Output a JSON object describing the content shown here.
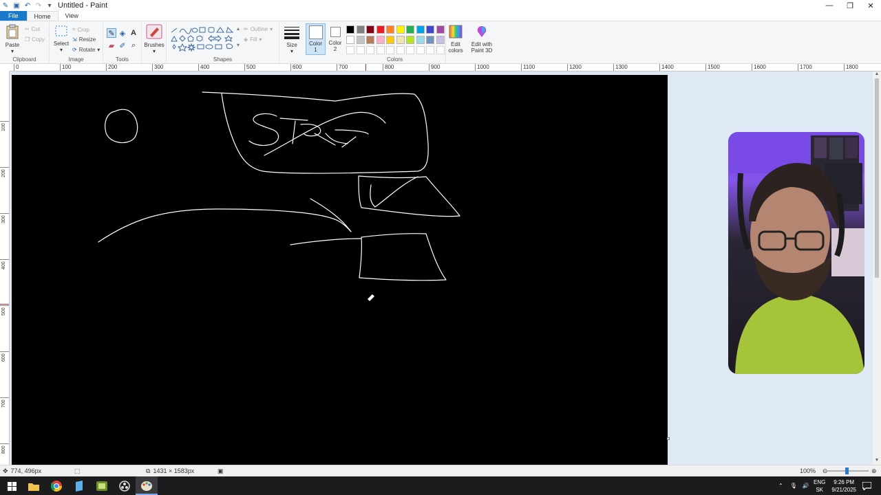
{
  "window": {
    "title": "Untitled - Paint",
    "controls": {
      "minimize": "—",
      "maximize": "❐",
      "close": "✕"
    }
  },
  "tabs": [
    "File",
    "Home",
    "View"
  ],
  "ribbon": {
    "clipboard": {
      "paste": "Paste",
      "cut": "Cut",
      "copy": "Copy",
      "label": "Clipboard"
    },
    "image": {
      "select": "Select",
      "crop": "Crop",
      "resize": "Resize",
      "rotate": "Rotate",
      "label": "Image"
    },
    "tools": {
      "label": "Tools",
      "text_tool": "A"
    },
    "brushes": {
      "label": "Brushes"
    },
    "shapes": {
      "outline": "Outline",
      "fill": "Fill",
      "label": "Shapes"
    },
    "size": {
      "label": "Size"
    },
    "color1": {
      "line1": "Color",
      "line2": "1"
    },
    "color2": {
      "line1": "Color",
      "line2": "2"
    },
    "colors": {
      "label": "Colors",
      "palette_row1": [
        "#000000",
        "#7f7f7f",
        "#880015",
        "#ed1c24",
        "#ff7f27",
        "#fff200",
        "#22b14c",
        "#00a2e8",
        "#3f48cc",
        "#a349a4"
      ],
      "palette_row2": [
        "#ffffff",
        "#c3c3c3",
        "#b97a57",
        "#ffaec9",
        "#ffc90e",
        "#efe4b0",
        "#b5e61d",
        "#99d9ea",
        "#7092be",
        "#c8bfe7"
      ]
    },
    "edit_colors": {
      "line1": "Edit",
      "line2": "colors"
    },
    "paint3d": {
      "line1": "Edit with",
      "line2": "Paint 3D"
    }
  },
  "ruler": {
    "h_labels": [
      "0",
      "100",
      "200",
      "300",
      "400",
      "500",
      "600",
      "700",
      "800",
      "900",
      "1000",
      "1100",
      "1200",
      "1300",
      "1400",
      "1500",
      "1600",
      "1700",
      "1800"
    ],
    "v_labels": [
      "100",
      "200",
      "300",
      "400",
      "500",
      "600",
      "700",
      "800"
    ]
  },
  "statusbar": {
    "cursor_pos": "774, 496px",
    "canvas_size": "1431 × 1583px",
    "zoom": "100%"
  },
  "taskbar": {
    "lang": "ENG",
    "region": "SK",
    "time": "9:26 PM",
    "date": "9/21/2025"
  }
}
